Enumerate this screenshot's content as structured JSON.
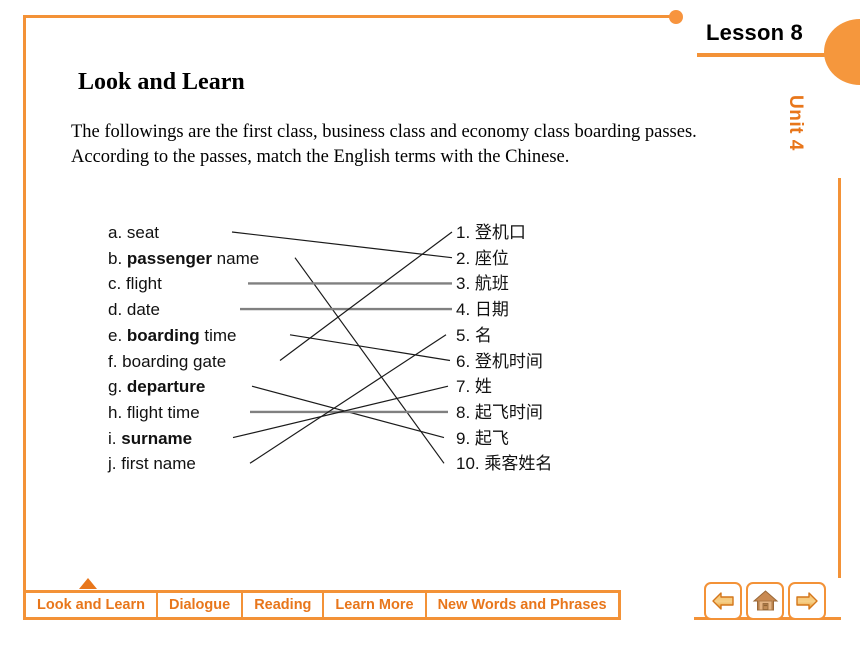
{
  "header": {
    "lesson_label": "Lesson 8",
    "unit_label": "Unit 4"
  },
  "content": {
    "section_title": "Look and Learn",
    "intro": "The followings are the first class, business class and economy class boarding passes. According to the passes, match the English terms with the Chinese."
  },
  "exercise": {
    "left_items": [
      {
        "marker": "a.",
        "pre": "",
        "bold": "",
        "post": "seat"
      },
      {
        "marker": "b.",
        "pre": "",
        "bold": "passenger",
        "post": " name"
      },
      {
        "marker": "c.",
        "pre": "",
        "bold": "",
        "post": "flight"
      },
      {
        "marker": "d.",
        "pre": "",
        "bold": "",
        "post": "date"
      },
      {
        "marker": "e.",
        "pre": "",
        "bold": "boarding",
        "post": " time"
      },
      {
        "marker": "f.",
        "pre": "",
        "bold": "",
        "post": "boarding gate"
      },
      {
        "marker": "g.",
        "pre": "",
        "bold": "departure",
        "post": ""
      },
      {
        "marker": "h.",
        "pre": "",
        "bold": "",
        "post": "flight time"
      },
      {
        "marker": "i.",
        "pre": "",
        "bold": "surname",
        "post": ""
      },
      {
        "marker": "j.",
        "pre": "",
        "bold": "",
        "post": "first name"
      }
    ],
    "right_items": [
      {
        "marker": "1.",
        "text": "登机口"
      },
      {
        "marker": "2.",
        "text": "座位"
      },
      {
        "marker": "3.",
        "text": "航班"
      },
      {
        "marker": "4.",
        "text": "日期"
      },
      {
        "marker": "5.",
        "text": "名"
      },
      {
        "marker": "6.",
        "text": "登机时间"
      },
      {
        "marker": "7.",
        "text": "姓"
      },
      {
        "marker": "8.",
        "text": "起飞时间"
      },
      {
        "marker": "9.",
        "text": "起飞"
      },
      {
        "marker": "10.",
        "text": "乘客姓名"
      }
    ],
    "connections": [
      {
        "from": "a",
        "to": "2"
      },
      {
        "from": "b",
        "to": "10"
      },
      {
        "from": "c",
        "to": "3"
      },
      {
        "from": "d",
        "to": "4"
      },
      {
        "from": "e",
        "to": "6"
      },
      {
        "from": "f",
        "to": "1"
      },
      {
        "from": "g",
        "to": "9"
      },
      {
        "from": "h",
        "to": "8"
      },
      {
        "from": "i",
        "to": "7"
      },
      {
        "from": "j",
        "to": "5"
      }
    ]
  },
  "navigation": {
    "tabs": [
      {
        "label": "Look and Learn",
        "active": true
      },
      {
        "label": "Dialogue",
        "active": false
      },
      {
        "label": "Reading",
        "active": false
      },
      {
        "label": "Learn More",
        "active": false
      },
      {
        "label": "New Words and Phrases",
        "active": false
      }
    ],
    "buttons": [
      {
        "name": "back",
        "icon": "left-arrow-icon"
      },
      {
        "name": "home",
        "icon": "home-icon"
      },
      {
        "name": "next",
        "icon": "right-arrow-icon"
      }
    ]
  },
  "colors": {
    "accent": "#F39237",
    "accent_dark": "#E8761B",
    "accent_light": "#F7943E",
    "line_gray": "#808080",
    "line_black": "#1A1A1A"
  }
}
